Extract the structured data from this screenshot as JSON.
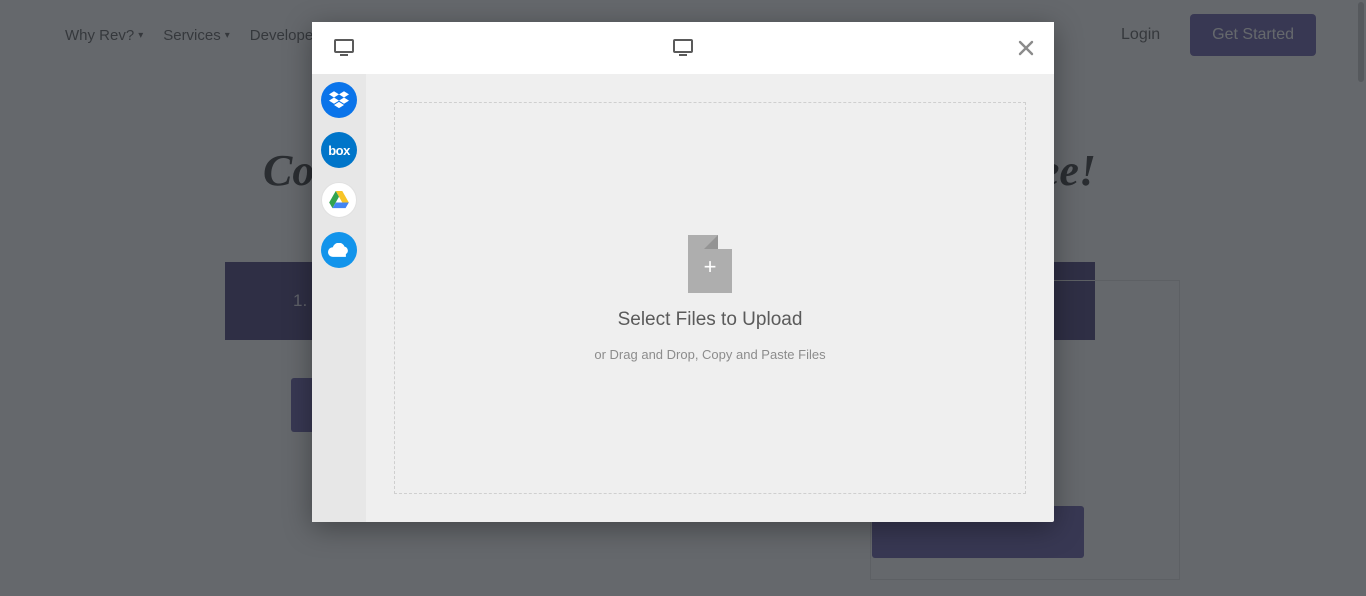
{
  "nav": {
    "items": [
      "Why Rev?",
      "Services",
      "Developers"
    ],
    "login": "Login",
    "get_started": "Get Started"
  },
  "hero": {
    "title_left": "Co",
    "title_right": "ee!"
  },
  "step": {
    "num": "1."
  },
  "modal": {
    "services": [
      {
        "name": "dropbox"
      },
      {
        "name": "box"
      },
      {
        "name": "google-drive"
      },
      {
        "name": "onedrive"
      }
    ],
    "box_label": "box",
    "dropzone": {
      "title": "Select Files to Upload",
      "subtitle": "or Drag and Drop, Copy and Paste Files"
    }
  }
}
